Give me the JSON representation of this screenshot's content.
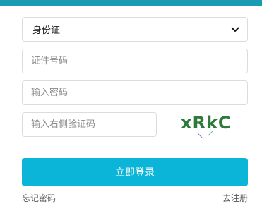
{
  "form": {
    "id_type": {
      "selected": "身份证",
      "icon": "chevron-down-icon"
    },
    "id_number": {
      "placeholder": "证件号码",
      "value": ""
    },
    "password": {
      "placeholder": "输入密码",
      "value": ""
    },
    "captcha_input": {
      "placeholder": "输入右侧验证码",
      "value": ""
    },
    "captcha_text": "xRkC",
    "login_label": "立即登录"
  },
  "links": {
    "forgot_password": "忘记密码",
    "register": "去注册"
  },
  "colors": {
    "top_bar": "#1b9bb3",
    "button": "#0bb5d8",
    "captcha_text": "#2e7a3a"
  }
}
